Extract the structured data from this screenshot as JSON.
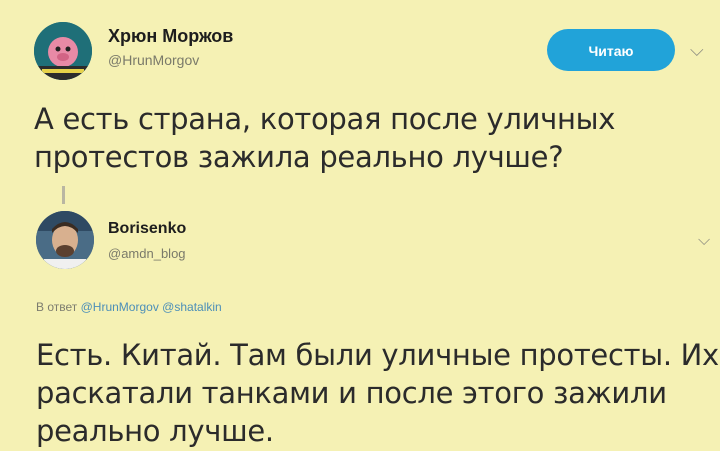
{
  "tweet": {
    "author_name": "Хрюн Моржов",
    "author_handle": "@HrunMorgov",
    "follow_label": "Читаю",
    "text": "А есть страна, которая после уличных протестов зажила реально лучше?"
  },
  "reply": {
    "author_name": "Borisenko",
    "author_handle": "@amdn_blog",
    "reply_prefix": "В ответ",
    "reply_mention_1": "@HrunMorgov",
    "reply_mention_2": "@shatalkin",
    "text": "Есть. Китай. Там были уличные протесты. Их раскатали танками и после этого зажили реально лучше."
  },
  "colors": {
    "background": "#f5f1b4",
    "follow_button": "#21a3d9",
    "mention": "#4c8fb8"
  },
  "icons": {
    "menu": "chevron-down-icon"
  }
}
